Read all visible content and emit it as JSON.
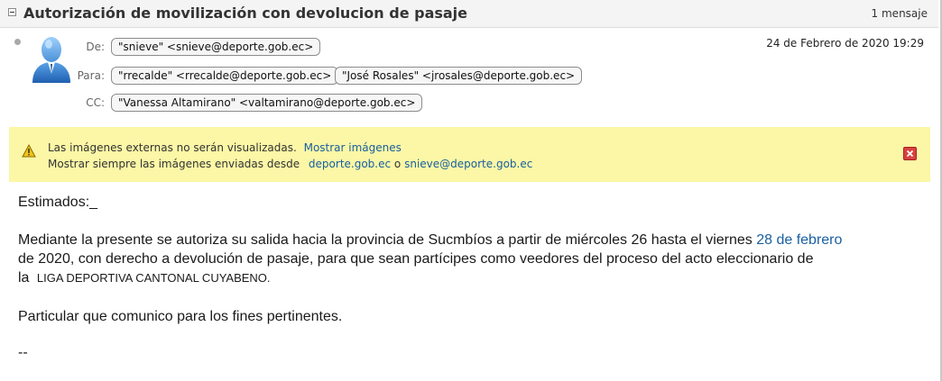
{
  "subject": {
    "title": "Autorización de movilización con devolucion de pasaje",
    "count": "1 mensaje"
  },
  "header": {
    "from_label": "De:",
    "from": "\"snieve\" <snieve@deporte.gob.ec>",
    "to_label": "Para:",
    "to": [
      "\"rrecalde\" <rrecalde@deporte.gob.ec>",
      "\"José Rosales\" <jrosales@deporte.gob.ec>"
    ],
    "cc_label": "CC:",
    "cc": [
      "\"Vanessa Altamirano\" <valtamirano@deporte.gob.ec>"
    ],
    "date": "24 de Febrero de 2020 19:29"
  },
  "banner": {
    "line1": "Las imágenes externas no serán visualizadas.",
    "show_link": "Mostrar imágenes",
    "line2": "Mostrar siempre las imágenes enviadas desde",
    "domain_link": "deporte.gob.ec",
    "or_text": "o",
    "sender_link": "snieve@deporte.gob.ec"
  },
  "body": {
    "greeting": "Estimados:_",
    "p1_a": "Mediante la presente se autoriza su salida hacia la provincia de Sucmbíos a partir de miércoles 26 hasta el viernes ",
    "p1_date": "28 de febrero",
    "p1_b": "de 2020, con derecho a devolución de pasaje, para que sean partícipes como veedores del proceso del acto eleccionario de",
    "p1_c": "la",
    "p1_org": "LIGA DEPORTIVA CANTONAL CUYABENO.",
    "p2": "Particular que comunico para los fines pertinentes.",
    "signature": "--"
  },
  "colors": {
    "banner_bg": "#fbf7a6",
    "link": "#1a5fa0",
    "close": "#d9413f"
  }
}
